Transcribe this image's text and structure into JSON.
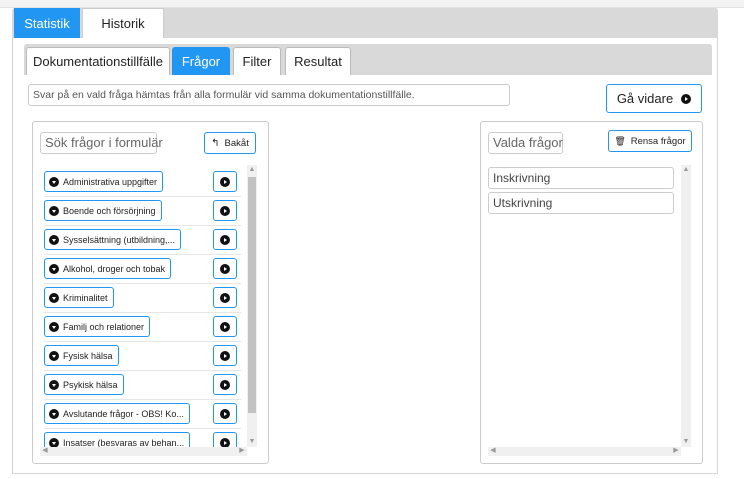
{
  "outer_tabs": [
    {
      "label": "Statistik",
      "active": true
    },
    {
      "label": "Historik",
      "active": false
    }
  ],
  "inner_tabs": [
    {
      "label": "Dokumentationstillfälle",
      "active": false
    },
    {
      "label": "Frågor",
      "active": true
    },
    {
      "label": "Filter",
      "active": false
    },
    {
      "label": "Resultat",
      "active": false
    }
  ],
  "info_text": "Svar på en vald fråga hämtas från alla formulär vid samma dokumentationstillfälle.",
  "ga_vidare_label": "Gå vidare",
  "left_panel": {
    "title": "Sök frågor i formulär",
    "back_label": "Bakåt",
    "questions": [
      "Administrativa uppgifter",
      "Boende och försörjning",
      "Sysselsättning (utbildning,...",
      "Alkohol, droger och tobak",
      "Kriminalitet",
      "Familj och relationer",
      "Fysisk hälsa",
      "Psykisk hälsa",
      "Avslutande frågor - OBS! Ko...",
      "Insatser (besvaras av behan..."
    ]
  },
  "right_panel": {
    "title": "Valda frågor",
    "clear_label": "Rensa frågor",
    "selected": [
      "Inskrivning",
      "Utskrivning"
    ]
  },
  "colors": {
    "accent": "#2196f3",
    "tab_bar": "#d9d9d9"
  }
}
